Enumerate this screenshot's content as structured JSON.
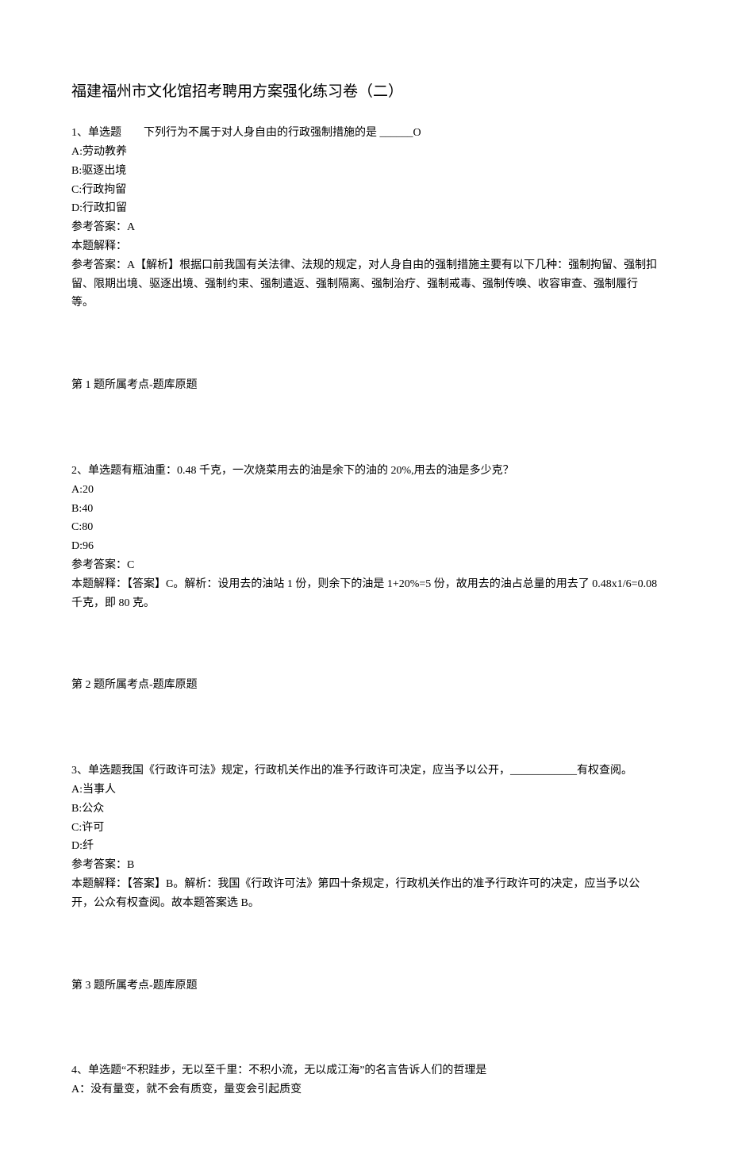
{
  "title": "福建福州市文化馆招考聘用方案强化练习卷（二）",
  "q1": {
    "stem": "1、单选题　　下列行为不属于对人身自由的行政强制措施的是 ______O",
    "optA": "A:劳动教养",
    "optB": "B:驱逐出境",
    "optC": "C:行政拘留",
    "optD": "D:行政扣留",
    "ans": "参考答案：A",
    "expl_label": "本题解释：",
    "expl": "参考答案：A【解析】根据口前我国有关法律、法规的规定，对人身自由的强制措施主要有以下几种：强制拘留、强制扣留、限期出境、驱逐出境、强制约束、强制遣返、强制隔离、强制治疗、强制戒毒、强制传唤、收容审查、强制履行等。",
    "footer": "第 1 题所属考点-题库原题"
  },
  "q2": {
    "stem": "2、单选题有瓶油重：0.48 千克，一次烧菜用去的油是余下的油的 20%,用去的油是多少克？",
    "optA": "A:20",
    "optB": "B:40",
    "optC": "C:80",
    "optD": "D:96",
    "ans": "参考答案：C",
    "expl": "本题解释：【答案】C。解析：设用去的油站 1 份，则余下的油是 1+20%=5 份，故用去的油占总量的用去了 0.48x1/6=0.08 千克，即 80 克。",
    "footer": "第 2 题所属考点-题库原题"
  },
  "q3": {
    "stem": "3、单选题我国《行政许可法》规定，行政机关作出的准予行政许可决定，应当予以公开，____________有权查阅。",
    "optA": "A:当事人",
    "optB": "B:公众",
    "optC": "C:许可",
    "optD": "D:纤",
    "ans": "参考答案：B",
    "expl": "本题解释：【答案】B。解析：我国《行政许可法》第四十条规定，行政机关作出的准予行政许可的决定，应当予以公开，公众有权查阅。故本题答案选 B。",
    "footer": "第 3 题所属考点-题库原题"
  },
  "q4": {
    "stem": "4、单选题“不积跬步，无以至千里：不积小流，无以成江海”的名言告诉人们的哲理是",
    "optA": "A：没有量变，就不会有质变，量变会引起质变"
  }
}
